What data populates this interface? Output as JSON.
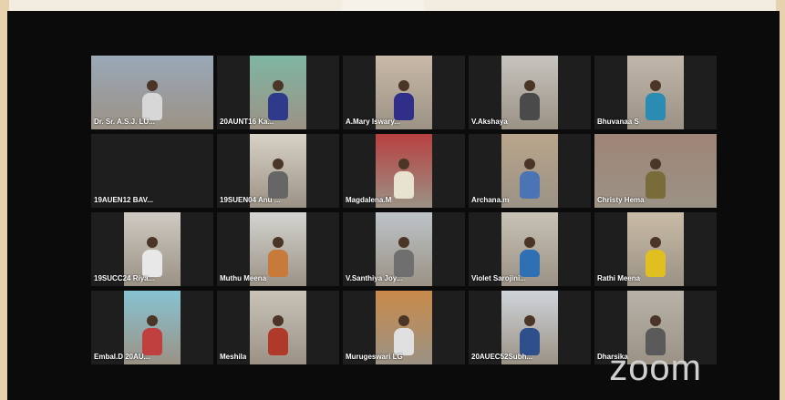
{
  "meeting": {
    "logo": "zoom",
    "participants": [
      {
        "name": "Dr. Sr. A.S.J. LU...",
        "video": "wide",
        "bg": "#9aa8b8",
        "shirt": "#d7d7d7"
      },
      {
        "name": "20AUNT16 Ka...",
        "video": "center",
        "bg": "#7fb6a3",
        "shirt": "#2f3b8a"
      },
      {
        "name": "A.Mary Iswary...",
        "video": "center",
        "bg": "#c9b9a8",
        "shirt": "#2f2f8a"
      },
      {
        "name": "V.Akshaya",
        "video": "center",
        "bg": "#c7c4bf",
        "shirt": "#4a4a4a"
      },
      {
        "name": "Bhuvanaa S",
        "video": "center",
        "bg": "#c0b7aa",
        "shirt": "#2c8bb3"
      },
      {
        "name": "19AUEN12 BAV...",
        "video": "none",
        "bg": "#1e1e1e",
        "shirt": "#1e1e1e"
      },
      {
        "name": "19SUEN04 Anu ...",
        "video": "center",
        "bg": "#d8d2c6",
        "shirt": "#666666"
      },
      {
        "name": "Magdalena.M",
        "video": "center",
        "bg": "#b84040",
        "shirt": "#e8e2d0"
      },
      {
        "name": "Archana.m",
        "video": "center",
        "bg": "#b9a58b",
        "shirt": "#4a74b3"
      },
      {
        "name": "Christy Hema",
        "video": "wide",
        "bg": "#9f8577",
        "shirt": "#7a6b3a"
      },
      {
        "name": "19SUCC24 Riya...",
        "video": "center",
        "bg": "#cfcac2",
        "shirt": "#e8e8e8"
      },
      {
        "name": "Muthu Meena",
        "video": "center",
        "bg": "#d4d4d0",
        "shirt": "#c87a3a"
      },
      {
        "name": "V.Santhiya Joy...",
        "video": "center",
        "bg": "#bcc4c8",
        "shirt": "#6f6f6f"
      },
      {
        "name": "Violet Sarojini...",
        "video": "center",
        "bg": "#c8c2b6",
        "shirt": "#2f6fb3"
      },
      {
        "name": "Rathi Meena",
        "video": "center",
        "bg": "#c9bba6",
        "shirt": "#e0c020"
      },
      {
        "name": "Embal.D 20AU...",
        "video": "center",
        "bg": "#87c3d2",
        "shirt": "#c04040"
      },
      {
        "name": "Meshila",
        "video": "center",
        "bg": "#c9c3b8",
        "shirt": "#b03a2a"
      },
      {
        "name": "Murugeswari LG",
        "video": "center",
        "bg": "#c98a4a",
        "shirt": "#e0e0e0"
      },
      {
        "name": "20AUEC52Subh...",
        "video": "center",
        "bg": "#cfd4da",
        "shirt": "#2f4f8a"
      },
      {
        "name": "Dharsika",
        "video": "center",
        "bg": "#b8b2a8",
        "shirt": "#5a5a5a"
      }
    ]
  }
}
